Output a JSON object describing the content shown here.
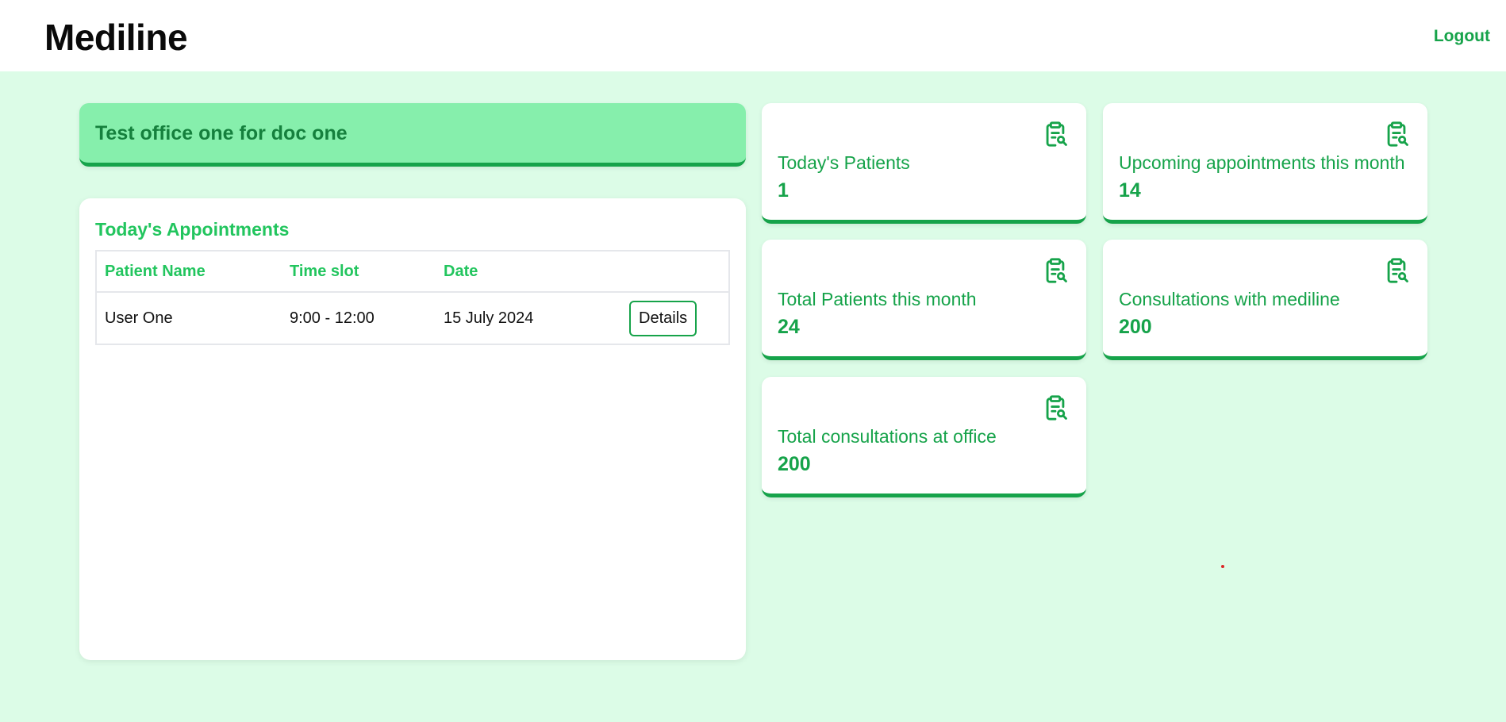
{
  "header": {
    "brand": "Mediline",
    "logout_label": "Logout"
  },
  "office": {
    "name": "Test office one for doc one"
  },
  "appointments": {
    "title": "Today's Appointments",
    "columns": [
      "Patient Name",
      "Time slot",
      "Date"
    ],
    "rows": [
      {
        "patient": "User One",
        "time_slot": "9:00 - 12:00",
        "date": "15 July 2024",
        "action_label": "Details"
      }
    ]
  },
  "stats": [
    {
      "icon": "clipboard-search-icon",
      "label": "Today's Patients",
      "value": "1"
    },
    {
      "icon": "clipboard-search-icon",
      "label": "Upcoming appointments this month",
      "value": "14"
    },
    {
      "icon": "clipboard-search-icon",
      "label": "Total Patients this month",
      "value": "24"
    },
    {
      "icon": "clipboard-search-icon",
      "label": "Consultations with mediline",
      "value": "200"
    },
    {
      "icon": "clipboard-search-icon",
      "label": "Total consultations at office",
      "value": "200"
    }
  ],
  "colors": {
    "page_bg": "#dcfce7",
    "accent": "#16a34a",
    "accent_light": "#22c55e",
    "banner_bg": "#86efac"
  }
}
